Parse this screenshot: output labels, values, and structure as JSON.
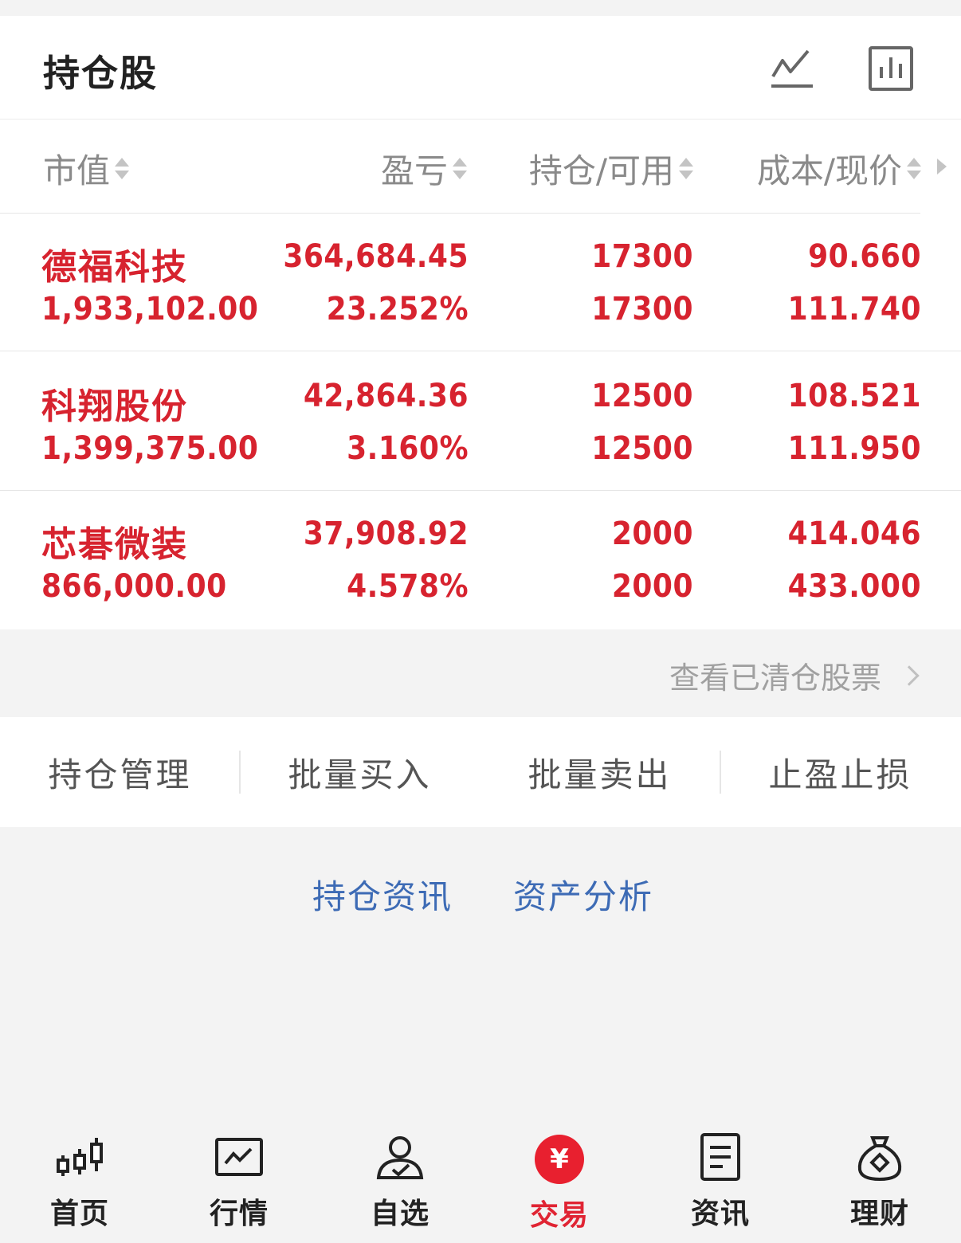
{
  "header": {
    "title": "持仓股"
  },
  "table": {
    "columns": [
      "市值",
      "盈亏",
      "持仓/可用",
      "成本/现价"
    ],
    "rows": [
      {
        "name": "德福科技",
        "market_value": "1,933,102.00",
        "pl_amount": "364,684.45",
        "pl_pct": "23.252%",
        "position": "17300",
        "available": "17300",
        "cost": "90.660",
        "price": "111.740"
      },
      {
        "name": "科翔股份",
        "market_value": "1,399,375.00",
        "pl_amount": "42,864.36",
        "pl_pct": "3.160%",
        "position": "12500",
        "available": "12500",
        "cost": "108.521",
        "price": "111.950"
      },
      {
        "name": "芯碁微装",
        "market_value": "866,000.00",
        "pl_amount": "37,908.92",
        "pl_pct": "4.578%",
        "position": "2000",
        "available": "2000",
        "cost": "414.046",
        "price": "433.000"
      }
    ]
  },
  "cleared_link": "查看已清仓股票",
  "actions": [
    "持仓管理",
    "批量买入",
    "批量卖出",
    "止盈止损"
  ],
  "links": [
    "持仓资讯",
    "资产分析"
  ],
  "tabs": [
    {
      "label": "首页",
      "icon": "candlestick-icon"
    },
    {
      "label": "行情",
      "icon": "market-chart-icon"
    },
    {
      "label": "自选",
      "icon": "user-check-icon"
    },
    {
      "label": "交易",
      "icon": "yen-icon",
      "active": true
    },
    {
      "label": "资讯",
      "icon": "document-icon"
    },
    {
      "label": "理财",
      "icon": "money-bag-icon"
    }
  ],
  "colors": {
    "up_red": "#d7232f",
    "link_blue": "#3d6bb5",
    "active_tab": "#e02433"
  }
}
